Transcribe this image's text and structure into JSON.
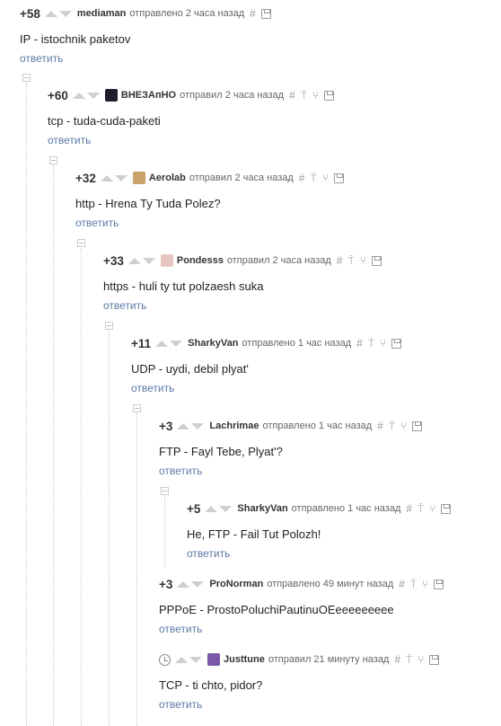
{
  "comments": [
    {
      "score": "+58",
      "user": "mediaman",
      "time": "отправлено 2 часа назад",
      "body": "IP - istochnik paketov",
      "reply": "ответить"
    },
    {
      "score": "+60",
      "user": "ВНЕЗАпНО",
      "time": "отправил 2 часа назад",
      "body": "tcp - tuda-cuda-paketi",
      "reply": "ответить"
    },
    {
      "score": "+32",
      "user": "Aerolab",
      "time": "отправил 2 часа назад",
      "body": "http - Hrena Ty Tuda Polez?",
      "reply": "ответить"
    },
    {
      "score": "+33",
      "user": "Pondesss",
      "time": "отправил 2 часа назад",
      "body": "https - huli ty tut polzaesh suka",
      "reply": "ответить"
    },
    {
      "score": "+11",
      "user": "SharkyVan",
      "time": "отправлено 1 час назад",
      "body": "UDP - uydi, debil plyat'",
      "reply": "ответить"
    },
    {
      "score": "+3",
      "user": "Lachrimae",
      "time": "отправлено 1 час назад",
      "body": "FTP - Fayl Tebe, Plyat'?",
      "reply": "ответить"
    },
    {
      "score": "+5",
      "user": "SharkyVan",
      "time": "отправлено 1 час назад",
      "body": "He, FTP - Fail Tut Polozh!",
      "reply": "ответить"
    },
    {
      "score": "+3",
      "user": "ProNorman",
      "time": "отправлено 49 минут назад",
      "body": "PPPoE - ProstoPoluchiPautinuOEeeeeeeeee",
      "reply": "ответить"
    },
    {
      "score": "",
      "user": "Justtune",
      "time": "отправил 21 минуту назад",
      "body": "TCP - ti chto, pidor?",
      "reply": "ответить"
    }
  ],
  "icons": {
    "hash": "#",
    "pin": "⍑",
    "branch": "⑂"
  },
  "colors": {
    "link": "#5a7aa6",
    "arrow": "#cfcfcf",
    "tree": "#cccccc"
  }
}
